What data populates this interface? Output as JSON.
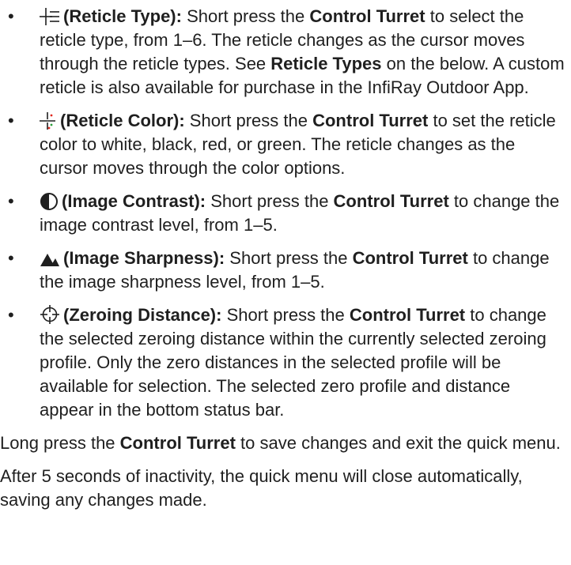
{
  "bullets": [
    {
      "icon": "reticle-type-icon",
      "term": "(Reticle Type):",
      "t1": " Short press the ",
      "b1": "Control Turret",
      "t2": " to select the reticle type, from 1–6. The reticle changes as the cursor moves through the reticle types. See ",
      "b2": "Reticle Types",
      "t3": " on the below. A custom reticle is also available for purchase in the InfiRay Outdoor App."
    },
    {
      "icon": "reticle-color-icon",
      "term": "(Reticle Color):",
      "t1": " Short press the ",
      "b1": "Control Turret",
      "t2": " to set the reticle color to white, black, red, or green. The reticle changes as the cursor moves through the color options."
    },
    {
      "icon": "image-contrast-icon",
      "term": "(Image Contrast):",
      "t1": " Short press the ",
      "b1": "Control Turret",
      "t2": " to change the image contrast level, from 1–5."
    },
    {
      "icon": "image-sharpness-icon",
      "term": "(Image Sharpness):",
      "t1": " Short press the ",
      "b1": "Control Turret",
      "t2": " to change the image sharpness level, from 1–5."
    },
    {
      "icon": "zeroing-distance-icon",
      "term": "(Zeroing Distance):",
      "t1": " Short press the ",
      "b1": "Control Turret",
      "t2": " to change the selected zeroing distance within the currently selected zeroing profile. Only the zero distances in the selected profile will be available for selection. The selected zero profile and distance appear in the bottom status bar."
    }
  ],
  "para1": {
    "t1": "Long press the ",
    "b1": "Control Turret",
    "t2": " to save changes and exit the quick menu."
  },
  "para2": "After 5 seconds of inactivity, the quick menu will close automatically, saving any changes made.",
  "colors": {
    "text": "#1f1f1f",
    "reticle_dot_red": "#e0261b",
    "reticle_dot_green": "#2a9d3a"
  }
}
